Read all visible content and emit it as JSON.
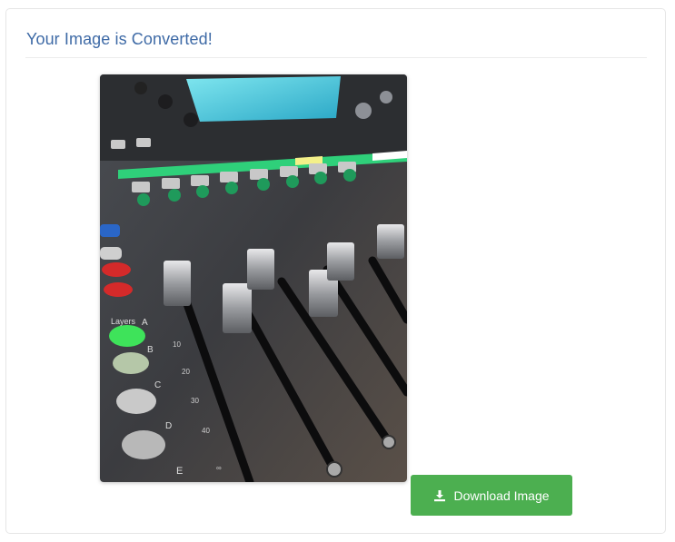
{
  "card": {
    "title": "Your Image is Converted!"
  },
  "image": {
    "description": "",
    "mixer_labels": {
      "layers": "Layers",
      "a": "A",
      "b": "B",
      "c": "C",
      "d": "D",
      "e": "E",
      "scale_10": "10",
      "scale_20": "20",
      "scale_30": "30",
      "scale_40": "40",
      "scale_inf": "∞"
    }
  },
  "actions": {
    "download_label": "Download Image",
    "download_icon": "download-icon"
  },
  "colors": {
    "title": "#3e6aa6",
    "button": "#4caf50"
  }
}
